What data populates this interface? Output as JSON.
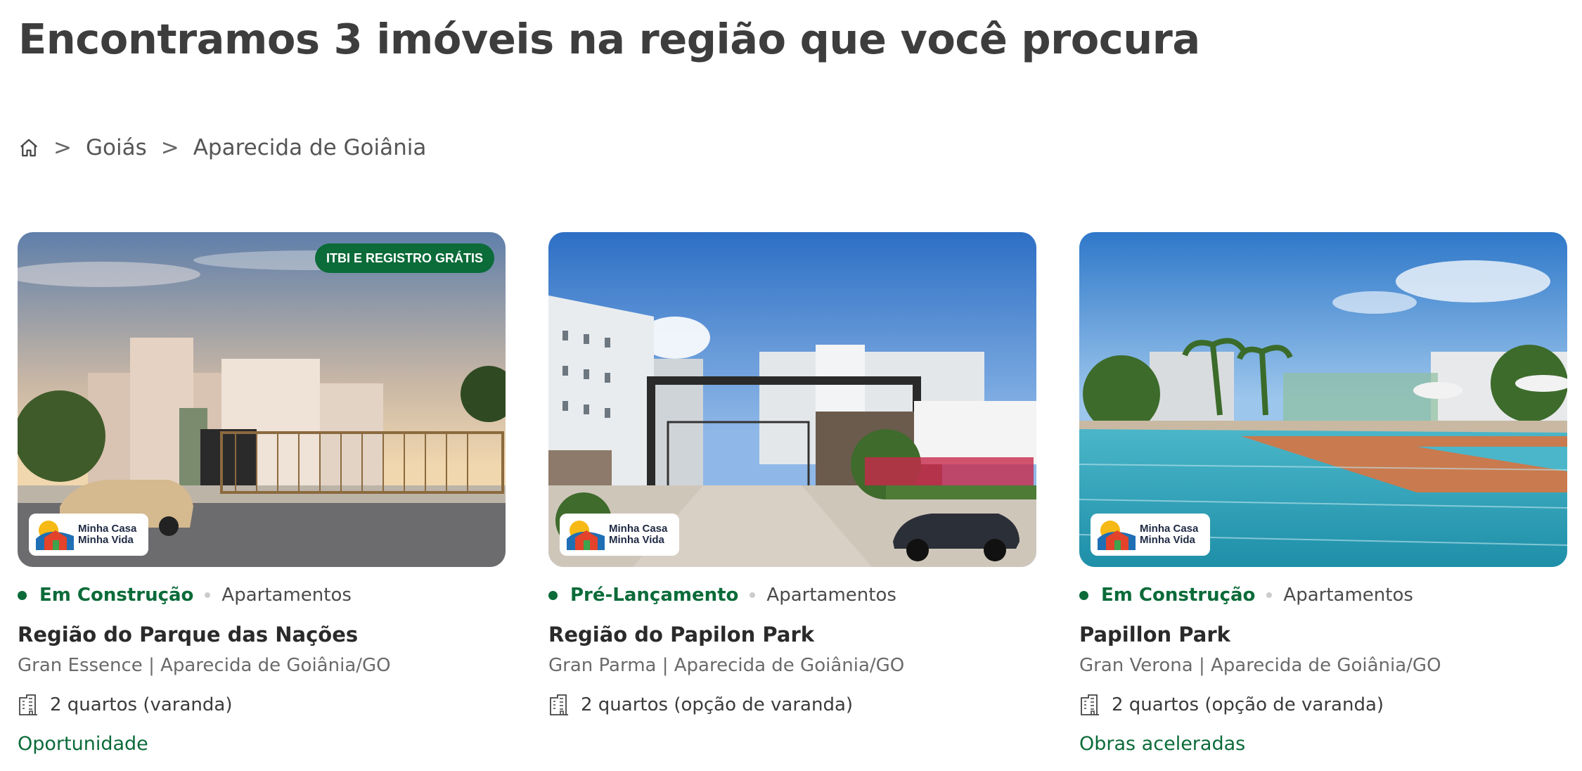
{
  "page": {
    "title": "Encontramos 3 imóveis na região que você procura"
  },
  "breadcrumb": {
    "home_icon": "home-icon",
    "separator": ">",
    "items": [
      "Goiás",
      "Aparecida de Goiânia"
    ]
  },
  "colors": {
    "accent": "#0b6b39",
    "text": "#3d3d3d",
    "muted": "#6a6a6a"
  },
  "program_logo_text": [
    "Minha Casa",
    "Minha Vida"
  ],
  "cards": [
    {
      "badge": "ITBI E REGISTRO GRÁTIS",
      "status": "Em Construção",
      "type": "Apartamentos",
      "title": "Região do Parque das Nações",
      "subtitle": "Gran Essence | Aparecida de Goiânia/GO",
      "rooms": "2 quartos (varanda)",
      "tag": "Oportunidade"
    },
    {
      "status": "Pré-Lançamento",
      "type": "Apartamentos",
      "title": "Região do Papilon Park",
      "subtitle": "Gran Parma | Aparecida de Goiânia/GO",
      "rooms": "2 quartos (opção de varanda)"
    },
    {
      "status": "Em Construção",
      "type": "Apartamentos",
      "title": "Papillon Park",
      "subtitle": "Gran Verona | Aparecida de Goiânia/GO",
      "rooms": "2 quartos (opção de varanda)",
      "tag": "Obras aceleradas"
    }
  ]
}
